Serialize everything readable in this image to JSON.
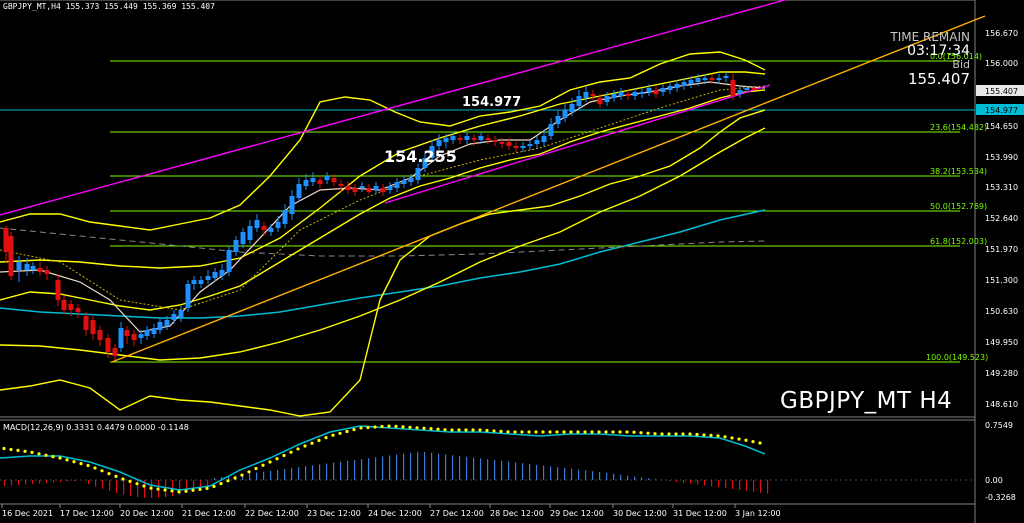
{
  "header": {
    "symbol_tf": "GBPJPY_MT,H4",
    "ohlc": "155.373 155.449 155.369 155.407"
  },
  "time_remain": {
    "label": "TIME REMAIN",
    "value": "03:17:34",
    "bid_label": "Bid",
    "bid_value": "155.407"
  },
  "watermark": "GBPJPY_MT H4",
  "annotations": {
    "high_label": "154.977",
    "low_label": "154.255"
  },
  "price_axis": {
    "ticks": [
      "156.670",
      "156.000",
      "155.407",
      "154.977",
      "154.650",
      "153.990",
      "153.310",
      "152.640",
      "151.970",
      "151.300",
      "150.630",
      "149.950",
      "149.280",
      "148.610"
    ],
    "current_price": "155.407",
    "line_price": "154.977"
  },
  "fibonacci": [
    {
      "label": "0.0(156.014)"
    },
    {
      "label": "23.6(154.482)"
    },
    {
      "label": "38.2(153.534)"
    },
    {
      "label": "50.0(152.769)"
    },
    {
      "label": "61.8(152.003)"
    },
    {
      "label": "100.0(149.523)"
    }
  ],
  "macd": {
    "label": "MACD(12,26,9) 0.3331 0.4479 0.0000 -0.1148",
    "ticks": [
      "0.7549",
      "0.00",
      "-0.3268"
    ]
  },
  "time_axis": {
    "labels": [
      "16 Dec 2021",
      "17 Dec 12:00",
      "20 Dec 12:00",
      "21 Dec 12:00",
      "22 Dec 12:00",
      "23 Dec 12:00",
      "24 Dec 12:00",
      "27 Dec 12:00",
      "28 Dec 12:00",
      "29 Dec 12:00",
      "30 Dec 12:00",
      "31 Dec 12:00",
      "3 Jan 12:00"
    ]
  },
  "colors": {
    "bull": "#1e90ff",
    "bear": "#e01010",
    "fib": "#7cfc00",
    "bollinger": "#ffff00",
    "channel": "#ff00ff",
    "trend": "#ffb000",
    "ma_long": "#00bcd4",
    "ma_short": "#ffffff",
    "macd_signal": "#ffff00",
    "macd_line": "#00bcd4"
  }
}
